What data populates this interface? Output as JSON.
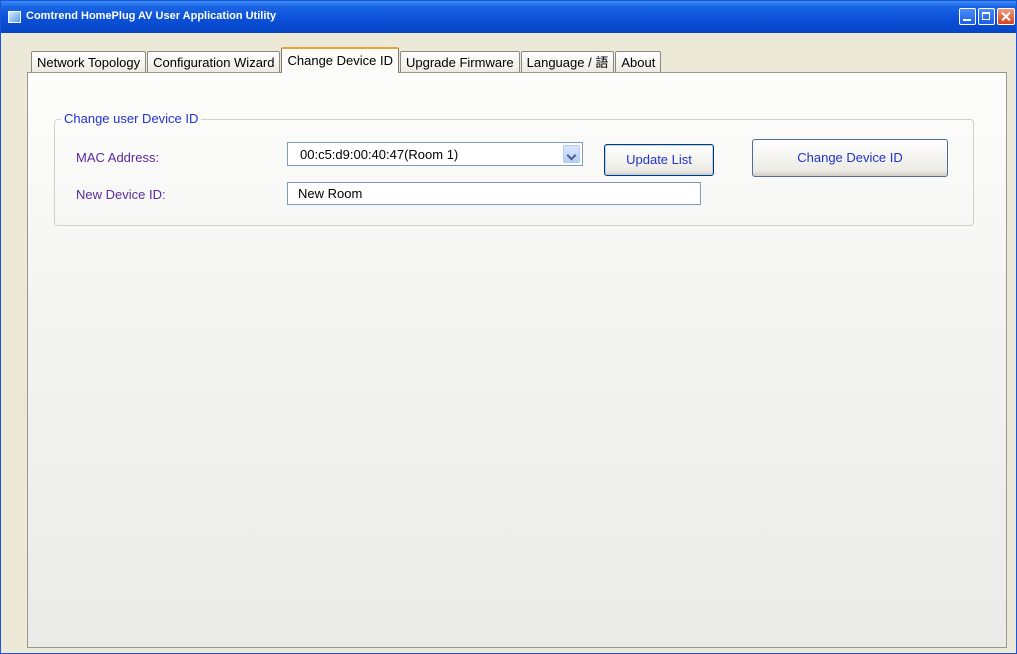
{
  "window": {
    "title": "Comtrend HomePlug AV User Application Utility"
  },
  "tabs": [
    {
      "label": "Network Topology",
      "active": false
    },
    {
      "label": "Configuration Wizard",
      "active": false
    },
    {
      "label": "Change Device ID",
      "active": true
    },
    {
      "label": "Upgrade Firmware",
      "active": false
    },
    {
      "label": "Language / 語",
      "active": false
    },
    {
      "label": "About",
      "active": false
    }
  ],
  "group": {
    "title": "Change user Device ID",
    "mac_label": "MAC Address:",
    "mac_selected": "00:c5:d9:00:40:47(Room 1)",
    "device_label": "New Device ID:",
    "device_value": "New Room",
    "update_button": "Update List",
    "change_button": "Change Device ID"
  },
  "icons": {
    "app": "homeplug-app-icon",
    "dropdown": "chevron-down-icon"
  }
}
